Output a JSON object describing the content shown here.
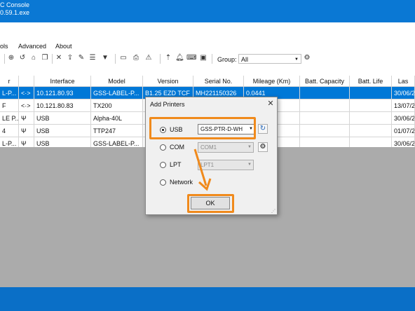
{
  "window": {
    "title_line1": "C Console",
    "title_line2": "0.59.1.exe"
  },
  "menu": [
    "ols",
    "Advanced",
    "About"
  ],
  "toolbar": {
    "group_label": "Group:",
    "group_value": "All",
    "icons": [
      "crosshair-icon",
      "refresh-icon",
      "home-icon",
      "copy-icon",
      "tool-icon",
      "upload-icon",
      "edit-icon",
      "list-icon",
      "wifi-icon",
      "terminal-icon",
      "printer-icon",
      "warning-icon",
      "bell-icon",
      "keyboard-icon",
      "chip-icon",
      "gear-icon"
    ]
  },
  "table": {
    "headers": [
      "r",
      "",
      "Interface",
      "Model",
      "Version",
      "Serial No.",
      "Mileage (Km)",
      "Batt. Capacity",
      "Batt. Life",
      "Las"
    ],
    "rows": [
      {
        "c0": "L-P...",
        "c1": "<·>",
        "interface": "10.121.80.93",
        "model": "GSS-LABEL-P...",
        "version": "B1.25 EZD TCF",
        "serial": "MH221150326",
        "mileage": "0.0441",
        "cap": "",
        "life": "",
        "last": "30/06/2",
        "selected": true
      },
      {
        "c0": "F",
        "c1": "<·>",
        "interface": "10.121.80.83",
        "model": "TX200",
        "version": "",
        "serial": "",
        "mileage": "",
        "cap": "",
        "life": "",
        "last": "13/07/2",
        "selected": false
      },
      {
        "c0": "LE P...",
        "c1": "Ψ",
        "interface": "USB",
        "model": "Alpha-40L",
        "version": "",
        "serial": "",
        "mileage": "",
        "cap": "",
        "life": "",
        "last": "30/06/2",
        "selected": false
      },
      {
        "c0": "4",
        "c1": "Ψ",
        "interface": "USB",
        "model": "TTP247",
        "version": "",
        "serial": "",
        "mileage": "",
        "cap": "",
        "life": "",
        "last": "01/07/2",
        "selected": false
      },
      {
        "c0": "L-P...",
        "c1": "Ψ",
        "interface": "USB",
        "model": "GSS-LABEL-P...",
        "version": "",
        "serial": "",
        "mileage": "",
        "cap": "",
        "life": "",
        "last": "30/06/2",
        "selected": false
      }
    ]
  },
  "dialog": {
    "title": "Add Printers",
    "usb_label": "USB",
    "usb_value": "GSS-PTR-D-WH",
    "com_label": "COM",
    "com_value": "COM1",
    "lpt_label": "LPT",
    "lpt_value": "LPT1",
    "network_label": "Network",
    "ok_label": "OK"
  },
  "colors": {
    "highlight": "#f08a1c",
    "selection": "#0078d7",
    "desktop": "#0a78d4"
  }
}
